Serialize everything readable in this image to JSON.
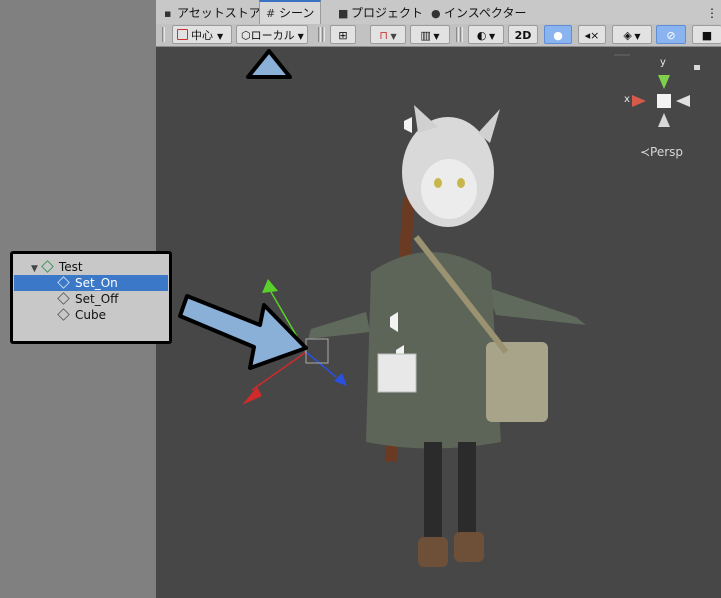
{
  "tabs": [
    {
      "label": "アセットストア",
      "icon": "bag-icon"
    },
    {
      "label": "シーン",
      "icon": "hash-icon"
    },
    {
      "label": "プロジェクト",
      "icon": "folder-icon"
    },
    {
      "label": "インスペクター",
      "icon": "info-icon"
    }
  ],
  "toolbar": {
    "pivot_label": "中心",
    "space_label": "ローカル",
    "mode_2d": "2D"
  },
  "scene": {
    "gizmo_x": "x",
    "gizmo_y": "y",
    "persp_label": "≺Persp"
  },
  "hierarchy": {
    "root": "Test",
    "children": [
      "Set_On",
      "Set_Off",
      "Cube"
    ],
    "selected": "Set_On"
  },
  "colors": {
    "accent": "#3c78c8",
    "annotation_arrow": "#8ab0d8",
    "scene_background": "#474747"
  }
}
